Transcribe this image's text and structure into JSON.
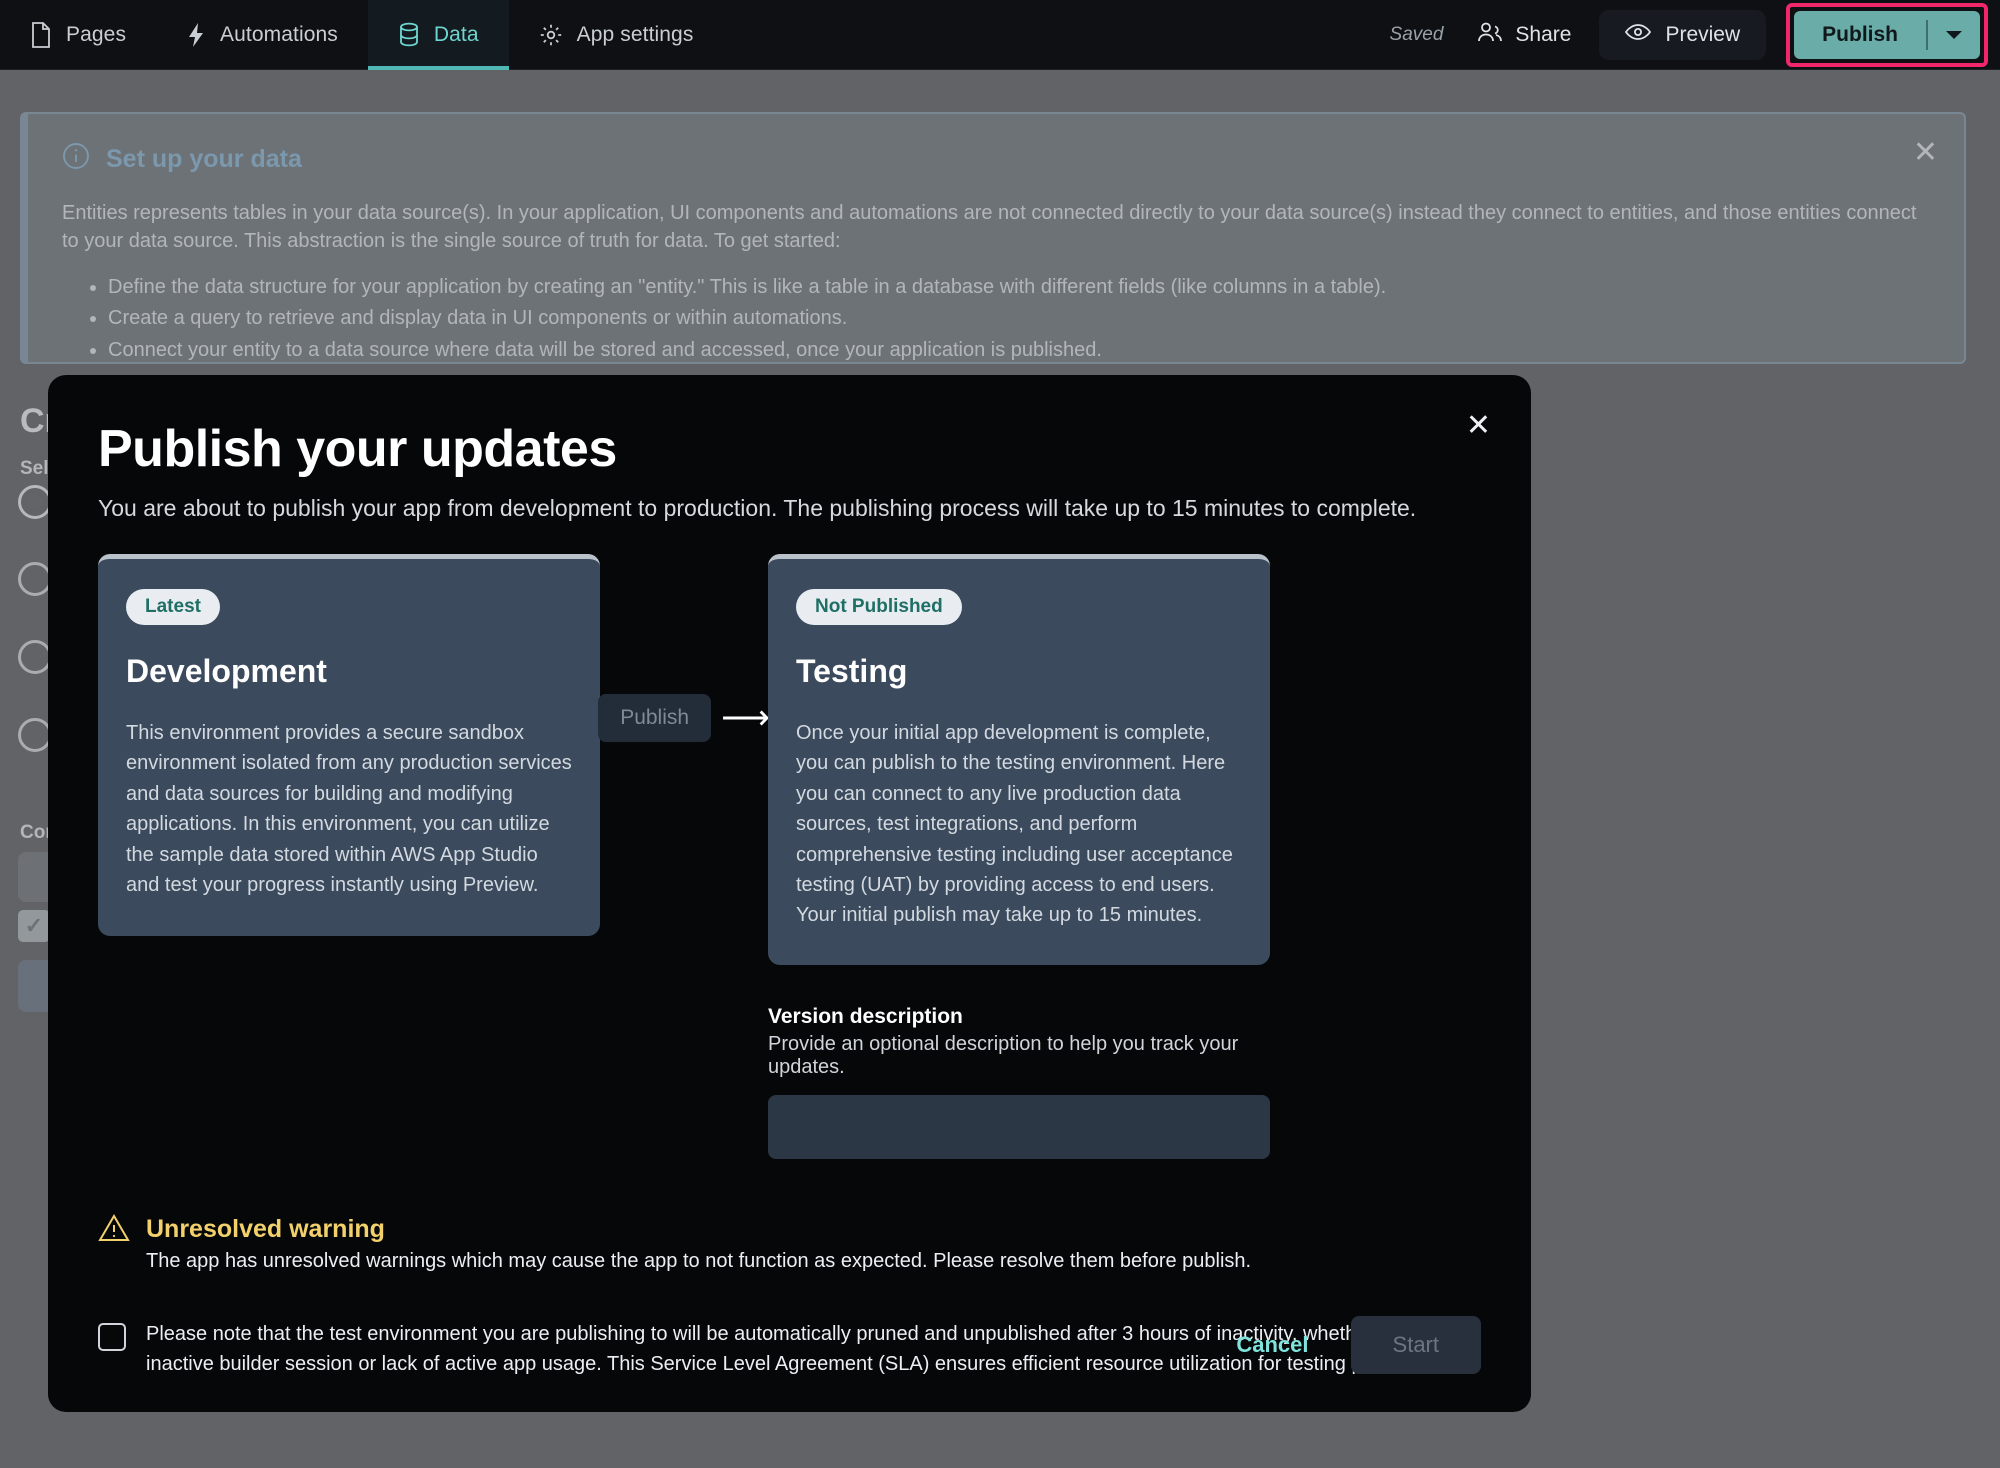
{
  "topbar": {
    "tabs": [
      {
        "label": "Pages",
        "icon": "page-icon",
        "active": false
      },
      {
        "label": "Automations",
        "icon": "lightning-icon",
        "active": false
      },
      {
        "label": "Data",
        "icon": "database-icon",
        "active": true
      },
      {
        "label": "App settings",
        "icon": "gear-icon",
        "active": false
      }
    ],
    "saved_label": "Saved",
    "share_label": "Share",
    "preview_label": "Preview",
    "publish_label": "Publish",
    "publish_accent": "#6aada8",
    "highlight_color": "#f2276b",
    "active_tab_color": "#6fd5d0"
  },
  "banner": {
    "title": "Set up your data",
    "paragraph": "Entities represents tables in your data source(s). In your application, UI components and automations are not connected directly to your data source(s) instead they connect to entities, and those entities connect to your data source. This abstraction is the single source of truth for data. To get started:",
    "bullets": [
      "Define the data structure for your application by creating an \"entity.\" This is like a table in a database with different fields (like columns in a table).",
      "Create a query to retrieve and display data in UI components or within automations.",
      "Connect your entity to a data source where data will be stored and accessed, once your application is published."
    ],
    "close_icon": "close-icon",
    "info_icon": "info-icon",
    "accent": "#4f95c8"
  },
  "background_page": {
    "title": "Cr",
    "select_label": "Sel",
    "connection_label": "Con"
  },
  "modal": {
    "title": "Publish your updates",
    "lede": "You are about to publish your app from development to production. The publishing process will take up to 15 minutes to complete.",
    "close_icon": "close-icon",
    "development": {
      "badge": "Latest",
      "heading": "Development",
      "description": "This environment provides a secure sandbox environment isolated from any production services and data sources for building and modifying applications. In this environment, you can utilize the sample data stored within AWS App Studio and test your progress instantly using Preview."
    },
    "connector": {
      "button_label": "Publish",
      "arrow_icon": "arrow-right-icon"
    },
    "testing": {
      "badge": "Not Published",
      "heading": "Testing",
      "description": "Once your initial app development is complete, you can publish to the testing environment. Here you can connect to any live production data sources, test integrations, and perform comprehensive testing including user acceptance testing (UAT) by providing access to end users. Your initial publish may take up to 15 minutes."
    },
    "version_description": {
      "label": "Version description",
      "hint": "Provide an optional description to help you track your updates.",
      "value": "",
      "placeholder": ""
    },
    "warning": {
      "icon": "warning-triangle-icon",
      "title": "Unresolved warning",
      "text": "The app has unresolved warnings which may cause the app to not function as expected. Please resolve them before publish.",
      "color": "#f2d06b"
    },
    "sla": {
      "checked": false,
      "text": "Please note that the test environment you are publishing to will be automatically pruned and unpublished after 3 hours of inactivity, whether due to an inactive builder session or lack of active app usage. This Service Level Agreement (SLA) ensures efficient resource utilization for testing purposes."
    },
    "footer": {
      "cancel_label": "Cancel",
      "start_label": "Start",
      "start_disabled": true
    }
  }
}
